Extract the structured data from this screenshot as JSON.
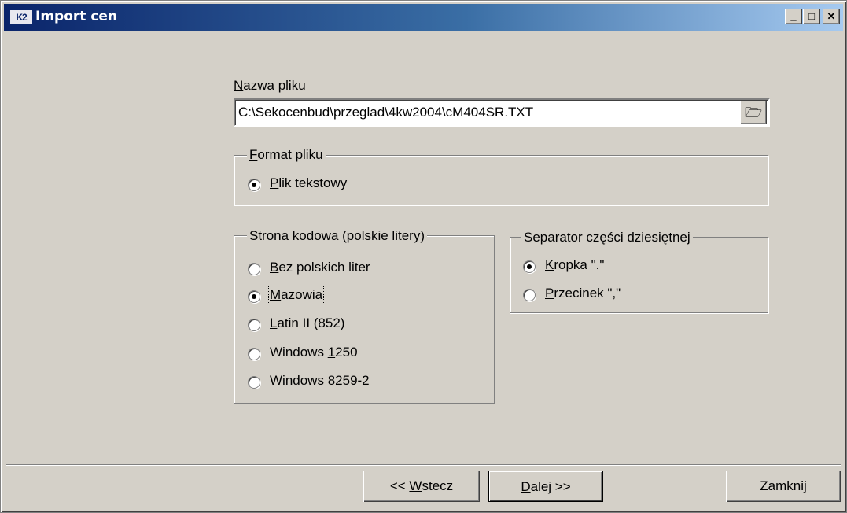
{
  "window": {
    "logo_text": "K2",
    "title": "Import cen",
    "minimize_glyph": "_",
    "maximize_glyph": "□",
    "close_glyph": "✕"
  },
  "file": {
    "label_mnemonic": "N",
    "label_rest": "azwa pliku",
    "path": "C:\\Sekocenbud\\przeglad\\4kw2004\\cM404SR.TXT",
    "browse_icon": "folder-open-icon",
    "browse_glyph": "🗁"
  },
  "format": {
    "legend_mnemonic": "F",
    "legend_rest": "ormat pliku",
    "options": [
      {
        "mnemonic": "P",
        "rest": "lik tekstowy",
        "checked": true
      }
    ]
  },
  "codepage": {
    "legend": "Strona kodowa (polskie litery)",
    "options": [
      {
        "pre": "",
        "mnemonic": "B",
        "rest": "ez polskich liter",
        "checked": false
      },
      {
        "pre": "",
        "mnemonic": "M",
        "rest": "azowia",
        "checked": true
      },
      {
        "pre": "",
        "mnemonic": "L",
        "rest": "atin II (852)",
        "checked": false
      },
      {
        "pre": "Windows ",
        "mnemonic": "1",
        "rest": "250",
        "checked": false
      },
      {
        "pre": "Windows ",
        "mnemonic": "8",
        "rest": "259-2",
        "checked": false
      }
    ]
  },
  "separator": {
    "legend": "Separator części dziesiętnej",
    "options": [
      {
        "mnemonic": "K",
        "rest": "ropka \".\"",
        "checked": true
      },
      {
        "mnemonic": "P",
        "rest": "rzecinek \",\"",
        "checked": false
      }
    ]
  },
  "buttons": {
    "back_pre": "<< ",
    "back_mnemonic": "W",
    "back_rest": "stecz",
    "next_mnemonic": "D",
    "next_rest": "alej >>",
    "close": "Zamknij"
  }
}
